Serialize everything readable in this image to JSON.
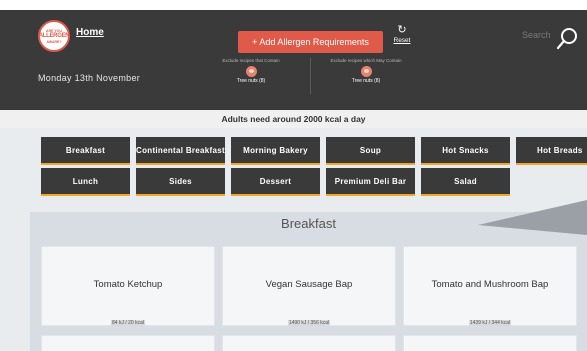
{
  "header": {
    "logo_text": [
      "ARE YOU",
      "ALLERGEN",
      "AWARE?"
    ],
    "home_label": "Home",
    "date": "Monday 13th November",
    "add_button_label": "+ Add Allergen Requirements",
    "reset_label": "Reset",
    "search_placeholder": "Search",
    "exclusions": [
      {
        "caption": "Exclude recipes that Contain",
        "item": "Tree nuts (8)"
      },
      {
        "caption": "Exclude recipes which May Contain",
        "item": "Tree nuts (8)"
      }
    ]
  },
  "intake_notice": "Adults need around 2000 kcal a day",
  "categories": [
    "Breakfast",
    "Continental Breakfast",
    "Morning Bakery",
    "Soup",
    "Hot Snacks",
    "Hot Breads",
    "Lunch",
    "Sides",
    "Dessert",
    "Premium Deli Bar",
    "Salad"
  ],
  "section": {
    "title": "Breakfast",
    "cards": [
      {
        "name": "Tomato Ketchup",
        "energy": "84 kJ / 20 kcal"
      },
      {
        "name": "Vegan Sausage Bap",
        "energy": "1490 kJ / 356 kcal"
      },
      {
        "name": "Tomato and Mushroom Bap",
        "energy": "1439 kJ / 344 kcal"
      }
    ]
  },
  "colors": {
    "header_bg": "#3a3a3a",
    "accent_red": "#e05a4a",
    "category_underline": "#f0a52b"
  }
}
